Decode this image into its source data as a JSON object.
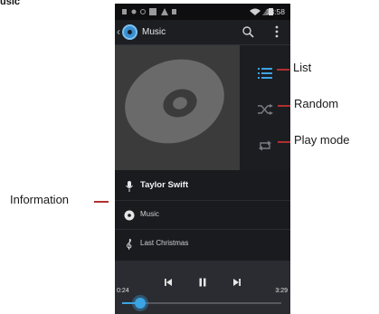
{
  "page": {
    "heading": "usic"
  },
  "status_bar": {
    "time": "13:58"
  },
  "app_bar": {
    "title": "Music",
    "icons": [
      "back-chevron",
      "music-app-icon",
      "search-icon",
      "more-vertical-icon"
    ]
  },
  "side_controls": [
    {
      "name": "list",
      "icon": "list-icon",
      "color": "#3aa4e4"
    },
    {
      "name": "random",
      "icon": "shuffle-icon",
      "color": "#7a7c82"
    },
    {
      "name": "play-mode",
      "icon": "repeat-icon",
      "color": "#7a7c82"
    }
  ],
  "info": {
    "artist": "Taylor Swift",
    "album": "Music",
    "song": "Last Christmas"
  },
  "player": {
    "current_time": "0:24",
    "total_time": "3:29",
    "progress": 0.115,
    "accent": "#3aa4e4"
  },
  "callouts": {
    "list": "List",
    "random": "Random",
    "play_mode": "Play mode",
    "information": "Information"
  }
}
